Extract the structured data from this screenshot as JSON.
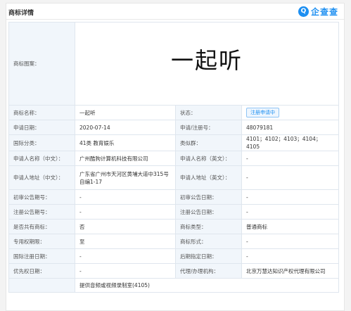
{
  "header": {
    "title": "商标详情",
    "brand_logo": "Q",
    "brand_name": "企查查"
  },
  "image_row": {
    "label": "商标图案：",
    "logo_text": "一起听"
  },
  "rows": [
    {
      "l1": "商标名称：",
      "v1": "一起听",
      "l2": "状态：",
      "v2": "注册申请中"
    },
    {
      "l1": "申请日期：",
      "v1": "2020-07-14",
      "l2": "申请/注册号：",
      "v2": "48079181"
    },
    {
      "l1": "国际分类：",
      "v1": "41类 教育娱乐",
      "l2": "类似群：",
      "v2": "4101；4102；4103；4104；4105"
    },
    {
      "l1": "申请人名称（中文）：",
      "v1": "广州酷狗计算机科技有限公司",
      "l2": "申请人名称（英文）：",
      "v2": "-"
    },
    {
      "l1": "申请人地址（中文）：",
      "v1": "广东省广州市天河区黄埔大道中315号自编1-17",
      "l2": "申请人地址（英文）：",
      "v2": "-"
    },
    {
      "l1": "初审公告期号：",
      "v1": "-",
      "l2": "初审公告日期：",
      "v2": "-"
    },
    {
      "l1": "注册公告期号：",
      "v1": "-",
      "l2": "注册公告日期：",
      "v2": "-"
    },
    {
      "l1": "是否共有商标：",
      "v1": "否",
      "l2": "商标类型：",
      "v2": "普通商标"
    },
    {
      "l1": "专用权期限：",
      "v1": "至",
      "l2": "商标形式：",
      "v2": "-"
    },
    {
      "l1": "国际注册日期：",
      "v1": "-",
      "l2": "后期指定日期：",
      "v2": "-"
    },
    {
      "l1": "优先权日期：",
      "v1": "-",
      "l2": "代理/办理机构：",
      "v2": "北京万慧达知识产权代理有限公司"
    }
  ],
  "last_row": {
    "v1": "提供音频或视频录制室(4105)"
  },
  "colors": {
    "accent": "#1d8ff1",
    "label_bg": "#f1f6fb"
  }
}
